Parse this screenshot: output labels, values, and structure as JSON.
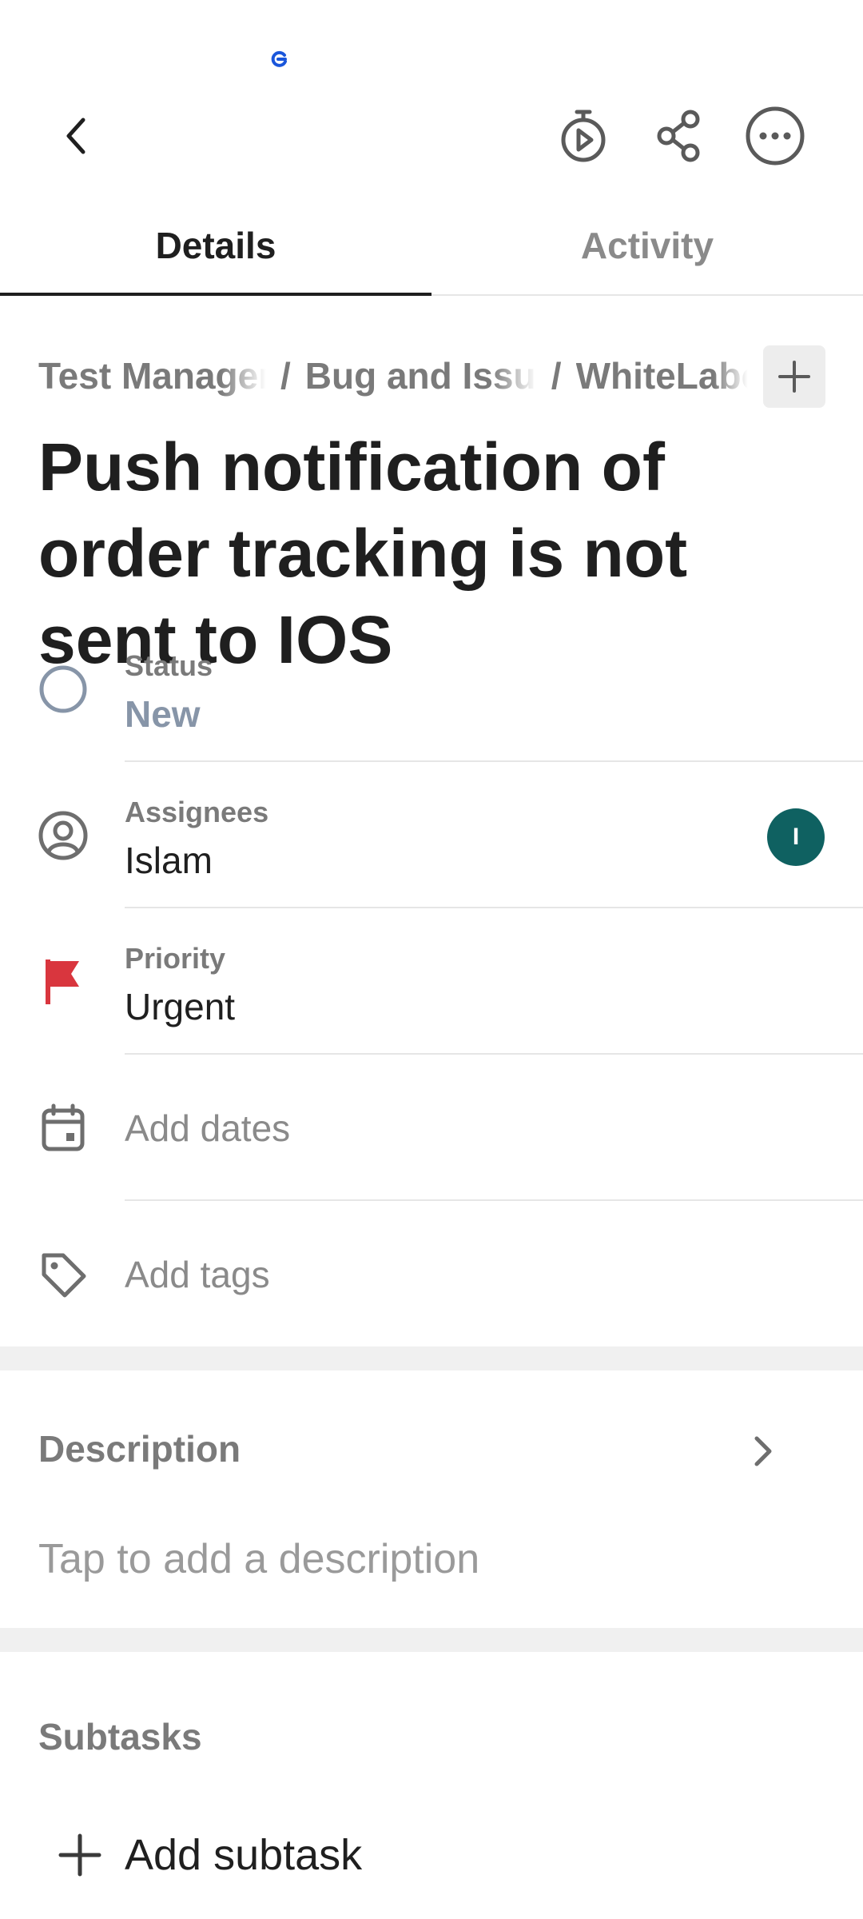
{
  "header": {
    "back_icon": "back-arrow-icon",
    "timer_icon": "timer-play-icon",
    "share_icon": "share-icon",
    "more_icon": "more-horizontal-icon"
  },
  "tabs": [
    {
      "label": "Details",
      "active": true
    },
    {
      "label": "Activity",
      "active": false
    }
  ],
  "breadcrumb": {
    "items": [
      "Test Management",
      "Bug and Issues",
      "WhiteLabel"
    ],
    "separator": "/"
  },
  "task": {
    "title": "Push notification of order tracking is not sent to IOS"
  },
  "fields": {
    "status": {
      "label": "Status",
      "value": "New",
      "color": "#8795a8"
    },
    "assignees": {
      "label": "Assignees",
      "value": "Islam",
      "avatar_initial": "I",
      "avatar_color": "#0f6161"
    },
    "priority": {
      "label": "Priority",
      "value": "Urgent",
      "flag_color": "#d9363e"
    },
    "dates": {
      "placeholder": "Add dates"
    },
    "tags": {
      "placeholder": "Add tags"
    }
  },
  "description": {
    "header": "Description",
    "placeholder": "Tap to add a description"
  },
  "subtasks": {
    "header": "Subtasks",
    "add_label": "Add subtask"
  }
}
